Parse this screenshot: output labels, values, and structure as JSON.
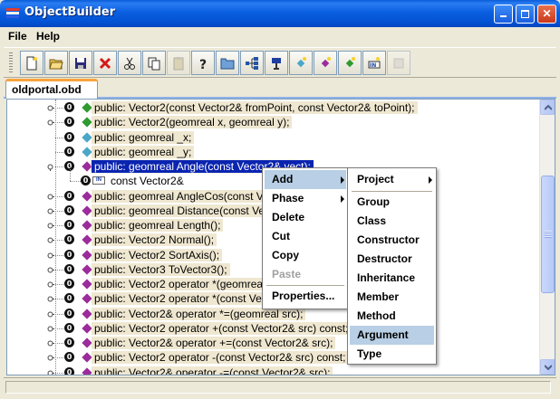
{
  "window": {
    "title": "ObjectBuilder",
    "controls": {
      "minimize": "minimize-icon",
      "maximize": "maximize-icon",
      "close": "close-icon"
    }
  },
  "menubar": {
    "items": [
      "File",
      "Help"
    ]
  },
  "toolbar": {
    "buttons": [
      {
        "icon": "new-document-icon"
      },
      {
        "icon": "open-folder-icon"
      },
      {
        "icon": "save-icon"
      },
      {
        "icon": "delete-icon"
      },
      {
        "icon": "cut-icon"
      },
      {
        "icon": "copy-icon"
      },
      {
        "icon": "paste-icon",
        "disabled": true
      },
      {
        "icon": "help-icon"
      },
      {
        "icon": "folder-icon"
      },
      {
        "icon": "hierarchy-icon"
      },
      {
        "icon": "class-icon"
      },
      {
        "icon": "add-member-icon"
      },
      {
        "icon": "add-method-icon"
      },
      {
        "icon": "add-field-icon"
      },
      {
        "icon": "add-argument-icon"
      },
      {
        "icon": "disabled-icon",
        "disabled": true
      }
    ]
  },
  "tab": {
    "label": "oldportal.obd"
  },
  "tree": {
    "rows": [
      {
        "label": "public: Vector2(const Vector2& fromPoint, const Vector2& toPoint);",
        "color": "#2f9a2f",
        "toggle": true
      },
      {
        "label": "public: Vector2(geomreal x, geomreal y);",
        "color": "#2f9a2f",
        "toggle": true
      },
      {
        "label": "public: geomreal _x;",
        "color": "#4aa7c8",
        "toggle": false
      },
      {
        "label": "public: geomreal _y;",
        "color": "#4aa7c8",
        "toggle": false
      },
      {
        "label": "public: geomreal Angle(const Vector2& vect);",
        "color": "#9b2c9b",
        "toggle": true,
        "expanded": true,
        "selected": true
      },
      {
        "label": "const Vector2&",
        "child": true
      },
      {
        "label": "public: geomreal AngleCos(const Vector2& vect);",
        "color": "#9b2c9b",
        "toggle": true
      },
      {
        "label": "public: geomreal Distance(const Vector2& point);",
        "color": "#9b2c9b",
        "toggle": true
      },
      {
        "label": "public: geomreal Length();",
        "color": "#9b2c9b",
        "toggle": true
      },
      {
        "label": "public: Vector2 Normal();",
        "color": "#9b2c9b",
        "toggle": true
      },
      {
        "label": "public: Vector2 SortAxis();",
        "color": "#9b2c9b",
        "toggle": true
      },
      {
        "label": "public: Vector3 ToVector3();",
        "color": "#9b2c9b",
        "toggle": true
      },
      {
        "label": "public: Vector2 operator *(geomreal n);",
        "color": "#9b2c9b",
        "toggle": true
      },
      {
        "label": "public: Vector2 operator *(const Vector2& src);",
        "color": "#9b2c9b",
        "toggle": true
      },
      {
        "label": "public: Vector2& operator *=(geomreal src);",
        "color": "#9b2c9b",
        "toggle": true
      },
      {
        "label": "public: Vector2 operator +(const Vector2& src) const;",
        "color": "#9b2c9b",
        "toggle": true
      },
      {
        "label": "public: Vector2& operator +=(const Vector2& src);",
        "color": "#9b2c9b",
        "toggle": true
      },
      {
        "label": "public: Vector2 operator -(const Vector2& src) const;",
        "color": "#9b2c9b",
        "toggle": true
      },
      {
        "label": "public: Vector2& operator -=(const Vector2& src);",
        "color": "#9b2c9b",
        "toggle": true
      }
    ],
    "badge": "0"
  },
  "context_menu": {
    "items": [
      {
        "label": "Add",
        "submenu": true,
        "highlighted": true
      },
      {
        "label": "Phase",
        "submenu": true
      },
      {
        "label": "Delete"
      },
      {
        "label": "Cut"
      },
      {
        "label": "Copy"
      },
      {
        "label": "Paste",
        "disabled": true
      },
      {
        "label": "Properties..."
      }
    ]
  },
  "add_submenu": {
    "items": [
      {
        "label": "Project",
        "submenu": true
      },
      {
        "label": "Group"
      },
      {
        "label": "Class"
      },
      {
        "label": "Constructor"
      },
      {
        "label": "Destructor"
      },
      {
        "label": "Inheritance"
      },
      {
        "label": "Member"
      },
      {
        "label": "Method"
      },
      {
        "label": "Argument",
        "highlighted": true
      },
      {
        "label": "Type"
      }
    ]
  }
}
